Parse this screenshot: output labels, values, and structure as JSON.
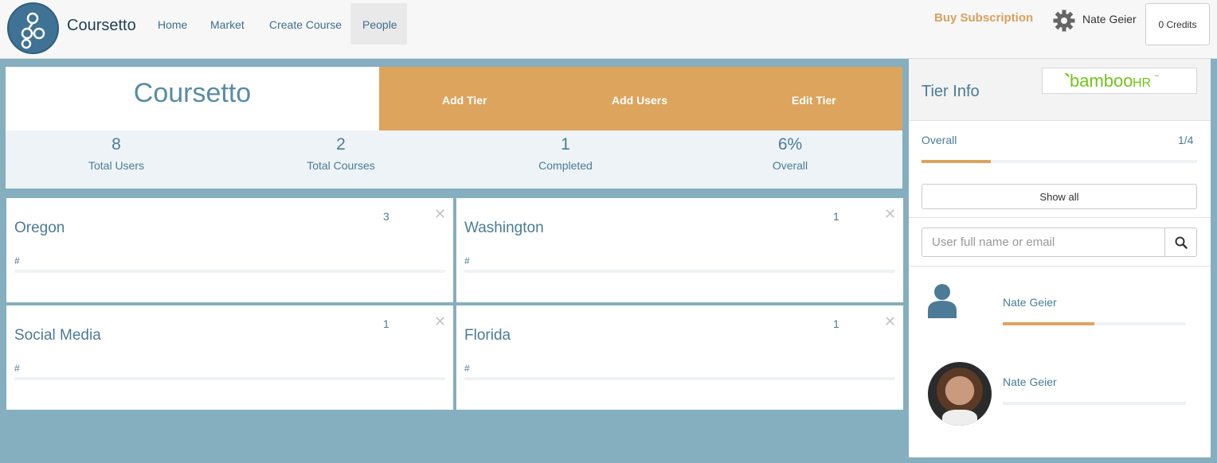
{
  "nav": {
    "brand": "Coursetto",
    "links": [
      "Home",
      "Market",
      "Create Course",
      "People"
    ],
    "active": "People",
    "buy_subscription": "Buy Subscription",
    "user": "Nate Geier",
    "credits": "0 Credits"
  },
  "summary": {
    "title": "Coursetto",
    "actions": [
      "Add Tier",
      "Add Users",
      "Edit Tier"
    ],
    "stats": [
      {
        "value": "8",
        "label": "Total Users"
      },
      {
        "value": "2",
        "label": "Total Courses"
      },
      {
        "value": "1",
        "label": "Completed"
      },
      {
        "value": "6%",
        "label": "Overall"
      }
    ]
  },
  "tiers": [
    {
      "name": "Oregon",
      "count": "3",
      "close": "✕",
      "hash": "#"
    },
    {
      "name": "Washington",
      "count": "1",
      "close": "✕",
      "hash": "#"
    },
    {
      "name": "Social Media",
      "count": "1",
      "close": "✕",
      "hash": "#"
    },
    {
      "name": "Florida",
      "count": "1",
      "close": "✕",
      "hash": "#"
    }
  ],
  "sidebar": {
    "title": "Tier Info",
    "logo_text": "bambooHR",
    "overall_label": "Overall",
    "overall_fraction": "1/4",
    "overall_progress": 0.25,
    "show_all": "Show all",
    "search_placeholder": "User full name or email",
    "users": [
      {
        "name": "Nate Geier",
        "progress": 0.5
      },
      {
        "name": "Nate Geier",
        "progress": 0
      }
    ]
  },
  "colors": {
    "accent": "#dca45d",
    "primary_text": "#4b7b96",
    "background": "#85aebf"
  }
}
